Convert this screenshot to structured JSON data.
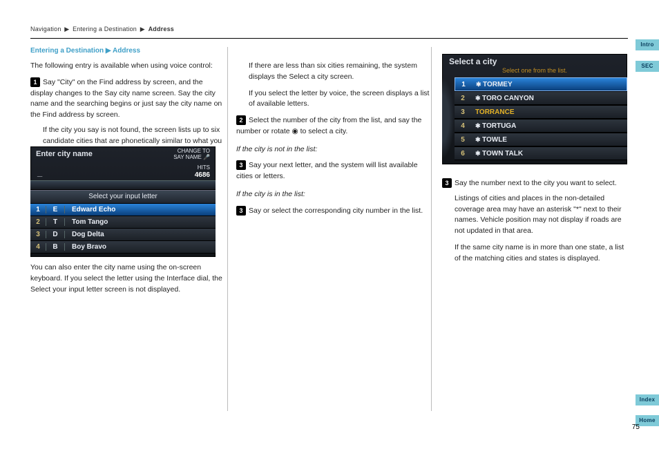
{
  "breadcrumb": {
    "a": "Navigation",
    "b": "Entering a Destination",
    "c": "Address",
    "sep": "▶"
  },
  "page_title": "Entering a Destination ▶ Address",
  "tabs": {
    "intro": "Intro",
    "sec": "SEC",
    "index": "Index",
    "home": "Home"
  },
  "page_number": "75",
  "col1": {
    "intro": "The following entry is available when using voice control:",
    "step_num": "1",
    "step_txt": "Say \"City\" on the Find address by screen, and the display changes to the Say city name screen. Say the city name and the searching begins or just say the city name on the Find address by screen.",
    "note": "If the city you say is not found, the screen lists up to six candidate cities that are phonetically similar to what you said. If the city you say is not in the list, say or select List and manually enter the city name using the on-screen keyboard.",
    "shot": {
      "title": "Enter city name",
      "change_to": "CHANGE TO",
      "say_name": "SAY NAME",
      "hits_label": "HITS",
      "hits_value": "4686",
      "banner": "Select your input letter",
      "rows": [
        {
          "n": "1",
          "l": "E",
          "t": "Edward Echo"
        },
        {
          "n": "2",
          "l": "T",
          "t": "Tom Tango"
        },
        {
          "n": "3",
          "l": "D",
          "t": "Dog Delta"
        },
        {
          "n": "4",
          "l": "B",
          "t": "Boy Bravo"
        }
      ]
    },
    "after_shot": "You can also enter the city name using the on-screen keyboard. If you select the letter using the Interface dial, the Select your input letter screen is not displayed."
  },
  "col2": {
    "p1": "If there are less than six cities remaining, the system displays the Select a city screen.",
    "p2": "If you select the letter by voice, the screen displays a list of available letters.",
    "step2_n": "2",
    "step2": "Select the number of the city from the list, and say the number or rotate ",
    "step2_after": " to select a city.",
    "sub_a": "If the city is not in the list:",
    "step3a_n": "3",
    "step3a": "Say your next letter, and the system will list available cities or letters.",
    "sub_b": "If the city is in the list:",
    "step3b_n": "3",
    "step3b": "Say or select the corresponding city number in the list.",
    "dial_icon": "◉"
  },
  "col3": {
    "shot": {
      "title": "Select a city",
      "subtitle": "Select one from the list.",
      "rows": [
        {
          "n": "1",
          "t": "TORMEY",
          "star": true,
          "hl": true
        },
        {
          "n": "2",
          "t": "TORO CANYON",
          "star": true
        },
        {
          "n": "3",
          "t": "TORRANCE",
          "star": false,
          "sel": true
        },
        {
          "n": "4",
          "t": "TORTUGA",
          "star": true
        },
        {
          "n": "5",
          "t": "TOWLE",
          "star": true
        },
        {
          "n": "6",
          "t": "TOWN TALK",
          "star": true
        }
      ]
    },
    "step3_n": "3",
    "step3": "Say the number next to the city you want to select.",
    "p1": "Listings of cities and places in the non-detailed coverage area may have an asterisk \"*\" next to their names. Vehicle position may not display if roads are not updated in that area.",
    "p2": "If the same city name is in more than one state, a list of the matching cities and states is displayed."
  }
}
